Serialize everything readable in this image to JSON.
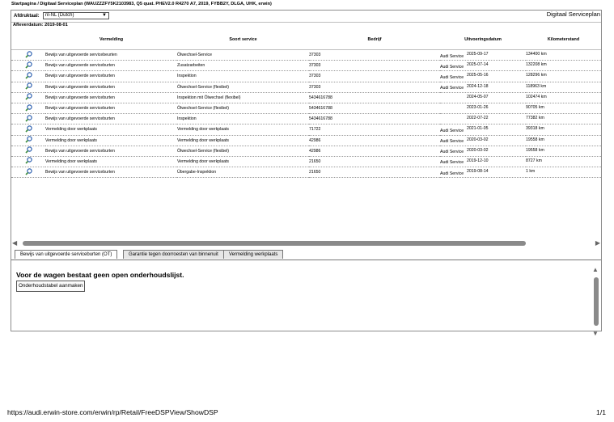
{
  "breadcrumb": "Startpagina / Digitaal Serviceplan (WAUZZZFY5K2103983, Q5 quat. PHEV2.0 R4270 A7, 2019, FYBB2Y, DLGA, UHK, erwin)",
  "language": {
    "label": "Afdruktaal:",
    "selected": "nl-NL (Dutch)"
  },
  "app_title": "Digitaal Serviceplan",
  "delivery_date": "Afleverdatum: 2019-08-01",
  "table": {
    "headers": [
      "Vermelding",
      "Soort service",
      "Bedrijf",
      "Uitvoeringsdatum",
      "Kilometerstand"
    ],
    "rows": [
      {
        "entry": "Bewijs van uitgevoerde servicebeurten",
        "service": "Ölwechsel-Service",
        "company": "37303",
        "company_name": "Audi Service",
        "date": "2025-09-17",
        "mileage": "134400 km"
      },
      {
        "entry": "Bewijs van uitgevoerde serviceburten",
        "service": "Zusatzarbeiten",
        "company": "37303",
        "company_name": "Audi Service",
        "date": "2025-07-14",
        "mileage": "132208 km"
      },
      {
        "entry": "Bewijs van uitgevoerde serviceburten",
        "service": "Inspektion",
        "company": "37303",
        "company_name": "Audi Service",
        "date": "2025-05-16",
        "mileage": "128296 km"
      },
      {
        "entry": "Bewijs van uitgevoerde serviceburten",
        "service": "Ölwechsel-Service (flexibel)",
        "company": "37303",
        "company_name": "Audi Service",
        "date": "2024-12-18",
        "mileage": "118963 km"
      },
      {
        "entry": "Bewijs van uitgevoerde serviceburten",
        "service": "Inspektion mit Ölwechsel (flexibel)",
        "company": "5434616788",
        "company_name": "",
        "date": "2024-05-07",
        "mileage": "102474 km"
      },
      {
        "entry": "Bewijs van uitgevoerde serviceburten",
        "service": "Ölwechsel-Service (flexibel)",
        "company": "5434616788",
        "company_name": "",
        "date": "2023-01-26",
        "mileage": "90705 km"
      },
      {
        "entry": "Bewijs van uitgevoerde serviceburten",
        "service": "Inspektion",
        "company": "5434616788",
        "company_name": "",
        "date": "2022-07-22",
        "mileage": "77382 km"
      },
      {
        "entry": "Vermelding door werkplaats",
        "service": "Vermelding door werkplaats",
        "company": "71722",
        "company_name": "Audi Service",
        "date": "2021-01-05",
        "mileage": "39318 km"
      },
      {
        "entry": "Vermelding door werkplaats",
        "service": "Vermelding door werkplaats",
        "company": "42986",
        "company_name": "Audi Service",
        "date": "2020-03-02",
        "mileage": "19558 km"
      },
      {
        "entry": "Bewijs van uitgevoerde serviceburten",
        "service": "Ölwechsel-Service (flexibel)",
        "company": "42986",
        "company_name": "Audi Service",
        "date": "2020-03-02",
        "mileage": "19558 km"
      },
      {
        "entry": "Vermelding door werkplaats",
        "service": "Vermelding door werkplaats",
        "company": "21650",
        "company_name": "Audi Service",
        "date": "2019-12-10",
        "mileage": "8727 km"
      },
      {
        "entry": "Bewijs van uitgevoerde serviceburten",
        "service": "Übergabe-Inspektion",
        "company": "21650",
        "company_name": "Audi Service",
        "date": "2019-08-14",
        "mileage": "1 km"
      }
    ]
  },
  "tabs": [
    "Bewijs van uitgevoerde serviceburten (OT)",
    "Garantie tegen doorroesten van binnenuit",
    "Vermelding werkplaats"
  ],
  "notice": "Voor de wagen bestaat geen open onderhoudslijst.",
  "make_button": "Onderhoudstabel aanmaken",
  "url": "https://audi.erwin-store.com/erwin/rp/Retail/FreeDSPView/ShowDSP",
  "page_number": "1/1",
  "icons": {
    "row": "magnifier-icon"
  },
  "colors": {
    "icon_blue": "#2c5fb0",
    "icon_green": "#3e8e3e",
    "scroll_thumb": "#8a8a8a"
  }
}
